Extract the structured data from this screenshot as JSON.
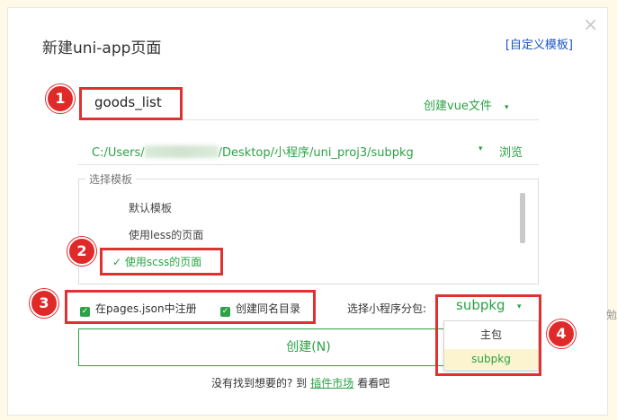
{
  "dialog": {
    "title": "新建uni-app页面",
    "custom_template_link": "[自定义模板]",
    "close_glyph": "×"
  },
  "page_name": {
    "value": "goods_list"
  },
  "create_vue": {
    "label": "创建vue文件",
    "caret": "▾"
  },
  "path": {
    "prefix": "C:/Users/",
    "suffix": "/Desktop/小程序/uni_proj3/subpkg",
    "caret": "▾",
    "browse_label": "浏览"
  },
  "templates": {
    "legend": "选择模板",
    "items": [
      {
        "label": "默认模板"
      },
      {
        "label": "使用less的页面"
      },
      {
        "label": "使用scss的页面",
        "selected": true
      }
    ],
    "check_glyph": "✓"
  },
  "options": {
    "register_label": "在pages.json中注册",
    "same_dir_label": "创建同名目录",
    "check_glyph": "✓",
    "subpackage_label": "选择小程序分包:",
    "subpackage_value": "subpkg",
    "caret": "▾"
  },
  "subpackage_dropdown": {
    "options": [
      "主包",
      "subpkg"
    ]
  },
  "create_button": {
    "label": "创建(N)"
  },
  "footer": {
    "prefix": "没有找到想要的? 到",
    "link": "插件市场",
    "suffix": "看看吧"
  },
  "badges": [
    "1",
    "2",
    "3",
    "4"
  ],
  "edge_text": "勉",
  "colors": {
    "accent": "#2ba245",
    "annotation": "#e03030",
    "link": "#1a56c6"
  }
}
